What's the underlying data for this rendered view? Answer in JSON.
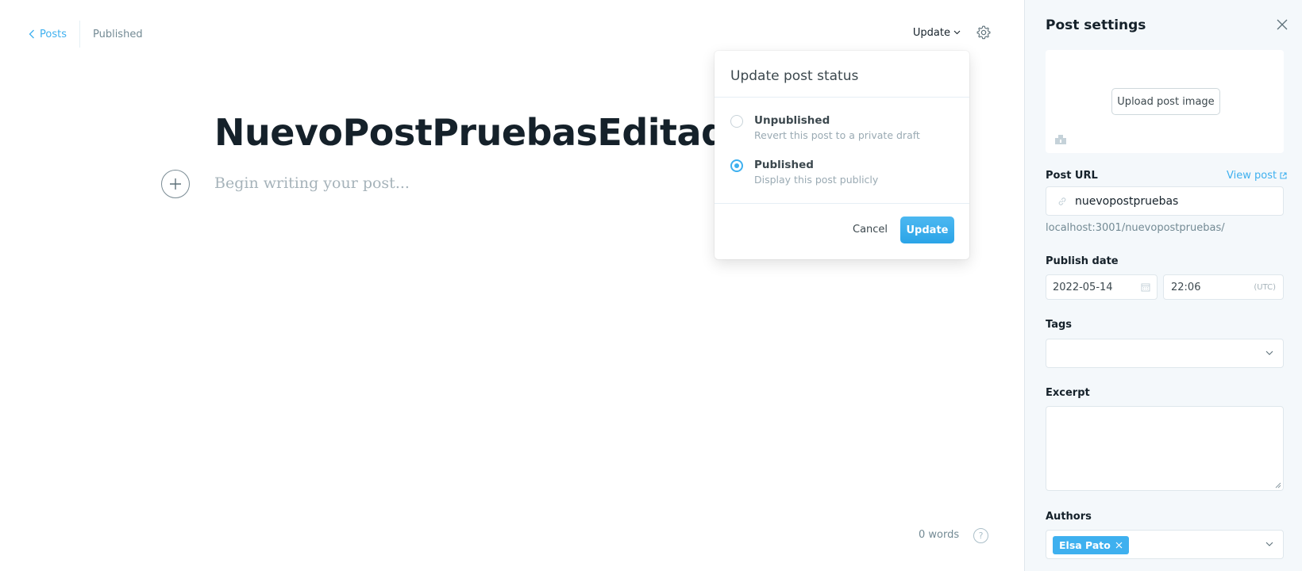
{
  "editor": {
    "back_label": "Posts",
    "status": "Published",
    "update_menu_label": "Update",
    "title": "NuevoPostPruebasEditado",
    "body_placeholder": "Begin writing your post...",
    "word_count": "0 words",
    "help_glyph": "?"
  },
  "popover": {
    "heading": "Update post status",
    "options": [
      {
        "title": "Unpublished",
        "description": "Revert this post to a private draft",
        "checked": false
      },
      {
        "title": "Published",
        "description": "Display this post publicly",
        "checked": true
      }
    ],
    "cancel_label": "Cancel",
    "update_label": "Update"
  },
  "settings": {
    "title": "Post settings",
    "upload_label": "Upload post image",
    "post_url_label": "Post URL",
    "view_post_label": "View post",
    "slug": "nuevopostpruebas",
    "url_hint": "localhost:3001/nuevopostpruebas/",
    "publish_date_label": "Publish date",
    "date": "2022-05-14",
    "time": "22:06",
    "timezone": "(UTC)",
    "tags_label": "Tags",
    "excerpt_label": "Excerpt",
    "authors_label": "Authors",
    "author": "Elsa Pato"
  },
  "colors": {
    "accent": "#3eb0ef",
    "text": "#15212a",
    "muted": "#738a94",
    "panel_bg": "#f4f8fb"
  },
  "icons": [
    "chevron-left-icon",
    "chevron-down-icon",
    "gear-icon",
    "plus-icon",
    "help-icon",
    "close-icon",
    "image-icon",
    "external-link-icon",
    "link-icon",
    "calendar-icon"
  ]
}
